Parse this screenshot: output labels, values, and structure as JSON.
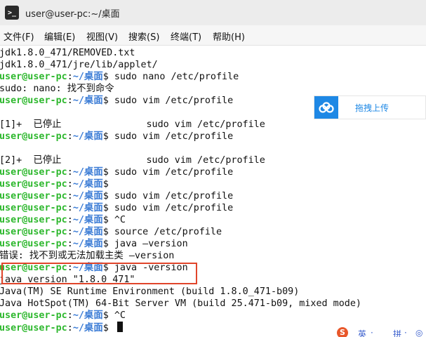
{
  "window": {
    "title": "user@user-pc:~/桌面",
    "icon": "terminal-icon"
  },
  "menu": [
    "文件(F)",
    "编辑(E)",
    "视图(V)",
    "搜索(S)",
    "终端(T)",
    "帮助(H)"
  ],
  "prompt": {
    "user": "user@user-pc",
    "sep": ":",
    "path": "~/桌面",
    "symbol": "$ "
  },
  "terminal_lines": [
    {
      "type": "output",
      "text": "jdk1.8.0_471/REMOVED.txt"
    },
    {
      "type": "output",
      "text": "jdk1.8.0_471/jre/lib/applet/"
    },
    {
      "type": "prompt",
      "cmd": "sudo nano /etc/profile"
    },
    {
      "type": "output",
      "text": "sudo: nano: 找不到命令"
    },
    {
      "type": "prompt",
      "cmd": "sudo vim /etc/profile"
    },
    {
      "type": "blank",
      "text": ""
    },
    {
      "type": "output",
      "text": "[1]+  已停止               sudo vim /etc/profile"
    },
    {
      "type": "prompt",
      "cmd": "sudo vim /etc/profile"
    },
    {
      "type": "blank",
      "text": ""
    },
    {
      "type": "output",
      "text": "[2]+  已停止               sudo vim /etc/profile"
    },
    {
      "type": "prompt",
      "cmd": "sudo vim /etc/profile"
    },
    {
      "type": "prompt",
      "cmd": ""
    },
    {
      "type": "prompt",
      "cmd": "sudo vim /etc/profile"
    },
    {
      "type": "prompt",
      "cmd": "sudo vim /etc/profile"
    },
    {
      "type": "prompt",
      "cmd": "^C"
    },
    {
      "type": "prompt",
      "cmd": "source /etc/profile"
    },
    {
      "type": "prompt",
      "cmd": "java —version"
    },
    {
      "type": "output",
      "text": "错误: 找不到或无法加载主类 —version"
    },
    {
      "type": "prompt",
      "cmd": "java -version"
    },
    {
      "type": "output",
      "text": "java version \"1.8.0_471\""
    },
    {
      "type": "output",
      "text": "Java(TM) SE Runtime Environment (build 1.8.0_471-b09)"
    },
    {
      "type": "output",
      "text": "Java HotSpot(TM) 64-Bit Server VM (build 25.471-b09, mixed mode)"
    },
    {
      "type": "prompt",
      "cmd": "^C"
    },
    {
      "type": "prompt",
      "cmd": "",
      "cursor": true
    }
  ],
  "upload_widget": {
    "label": "拖拽上传",
    "icon": "cloud-icon",
    "accent": "#1e88e5"
  },
  "ime": {
    "logo": "S",
    "items": [
      "英",
      "·",
      "拼",
      "·",
      "◎"
    ]
  },
  "colors": {
    "prompt_user": "#2eb82e",
    "prompt_path": "#3a7bd5",
    "highlight": "#e0452b"
  }
}
